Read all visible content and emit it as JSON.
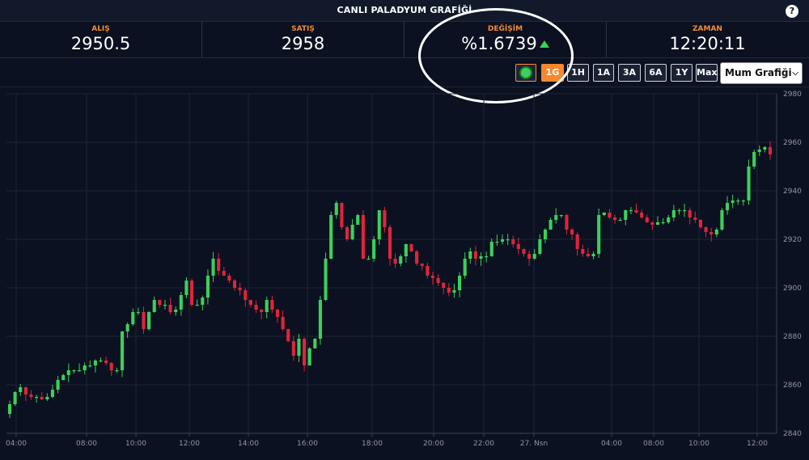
{
  "header": {
    "title": "CANLI PALADYUM GRAFİĞİ",
    "help_label": "?"
  },
  "stats": [
    {
      "label": "ALIŞ",
      "value": "2950.5"
    },
    {
      "label": "SATIŞ",
      "value": "2958"
    },
    {
      "label": "DEĞİŞİM",
      "value": "%1.6739"
    },
    {
      "label": "ZAMAN",
      "value": "12:20:11"
    }
  ],
  "colors": {
    "up": "#3cd05a",
    "down": "#e0243c",
    "accent": "#f5872e",
    "background": "#0b1120",
    "grid": "#1c2535"
  },
  "toolbar": {
    "ranges": [
      "1G",
      "1H",
      "1A",
      "3A",
      "6A",
      "1Y",
      "Max"
    ],
    "active_range": "1G",
    "chart_type": "Mum Grafiği"
  },
  "chart_data": {
    "type": "candlestick",
    "ylim": [
      2840,
      2980
    ],
    "y_ticks": [
      2840,
      2860,
      2880,
      2900,
      2920,
      2940,
      2960,
      2980
    ],
    "x_ticks": [
      "04:00",
      "08:00",
      "10:00",
      "12:00",
      "14:00",
      "16:00",
      "18:00",
      "20:00",
      "22:00",
      "27. Nsn",
      "04:00",
      "08:00",
      "10:00",
      "12:00"
    ],
    "grid": true,
    "close_series": [
      2852,
      2857,
      2859,
      2856,
      2855,
      2855,
      2854,
      2855,
      2858,
      2862,
      2864,
      2866,
      2866,
      2866,
      2868,
      2868,
      2870,
      2870,
      2869,
      2866,
      2866,
      2882,
      2885,
      2890,
      2890,
      2883,
      2890,
      2895,
      2893,
      2893,
      2890,
      2891,
      2897,
      2903,
      2893,
      2893,
      2896,
      2905,
      2912,
      2907,
      2905,
      2903,
      2900,
      2899,
      2895,
      2893,
      2891,
      2890,
      2895,
      2891,
      2888,
      2883,
      2878,
      2872,
      2879,
      2868,
      2875,
      2879,
      2895,
      2912,
      2930,
      2935,
      2925,
      2920,
      2926,
      2930,
      2912,
      2912,
      2920,
      2932,
      2925,
      2912,
      2910,
      2913,
      2918,
      2915,
      2910,
      2909,
      2905,
      2904,
      2902,
      2900,
      2898,
      2899,
      2905,
      2912,
      2915,
      2912,
      2913,
      2913,
      2919,
      2919,
      2920,
      2920,
      2918,
      2916,
      2914,
      2912,
      2914,
      2920,
      2924,
      2928,
      2930,
      2930,
      2924,
      2922,
      2916,
      2914,
      2913,
      2914,
      2930,
      2931,
      2929,
      2928,
      2928,
      2932,
      2932,
      2931,
      2929,
      2927,
      2926,
      2927,
      2927,
      2929,
      2932,
      2932,
      2932,
      2929,
      2928,
      2925,
      2923,
      2922,
      2924,
      2932,
      2935,
      2936,
      2936,
      2936,
      2950,
      2956,
      2957,
      2958,
      2955
    ]
  }
}
